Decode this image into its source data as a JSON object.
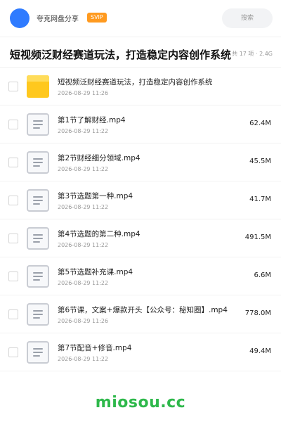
{
  "header": {
    "share_name": "夸克网盘分享",
    "badge": "SVIP",
    "search_label": "搜索"
  },
  "title_bar": {
    "title": "短视频泛财经赛道玩法，打造稳定内容创作系统",
    "meta": "共 17 项 · 2.4G"
  },
  "files": [
    {
      "name": "短视频泛财经赛道玩法，打造稳定内容创作系统",
      "date": "2026-08-29 11:26",
      "size": "",
      "icon": "folder-icon"
    },
    {
      "name": "第1节了解财经.mp4",
      "date": "2026-08-29 11:22",
      "size": "62.4M",
      "icon": "file-icon"
    },
    {
      "name": "第2节财经细分领域.mp4",
      "date": "2026-08-29 11:22",
      "size": "45.5M",
      "icon": "file-icon"
    },
    {
      "name": "第3节选题第一种.mp4",
      "date": "2026-08-29 11:22",
      "size": "41.7M",
      "icon": "file-icon"
    },
    {
      "name": "第4节选题的第二种.mp4",
      "date": "2026-08-29 11:22",
      "size": "491.5M",
      "icon": "file-icon"
    },
    {
      "name": "第5节选题补充课.mp4",
      "date": "2026-08-29 11:22",
      "size": "6.6M",
      "icon": "file-icon"
    },
    {
      "name": "第6节课，文案+爆款开头【公众号：秘知圈】.mp4",
      "date": "2026-08-29 11:26",
      "size": "778.0M",
      "icon": "file-icon"
    },
    {
      "name": "第7节配音+修音.mp4",
      "date": "2026-08-29 11:22",
      "size": "49.4M",
      "icon": "file-icon"
    }
  ],
  "watermark": "miosou.cc",
  "colors": {
    "brand_blue": "#2f7bff",
    "svip_orange": "#ff9a1f",
    "folder_yellow": "#ffc81e",
    "watermark_green": "#2eb84b"
  }
}
